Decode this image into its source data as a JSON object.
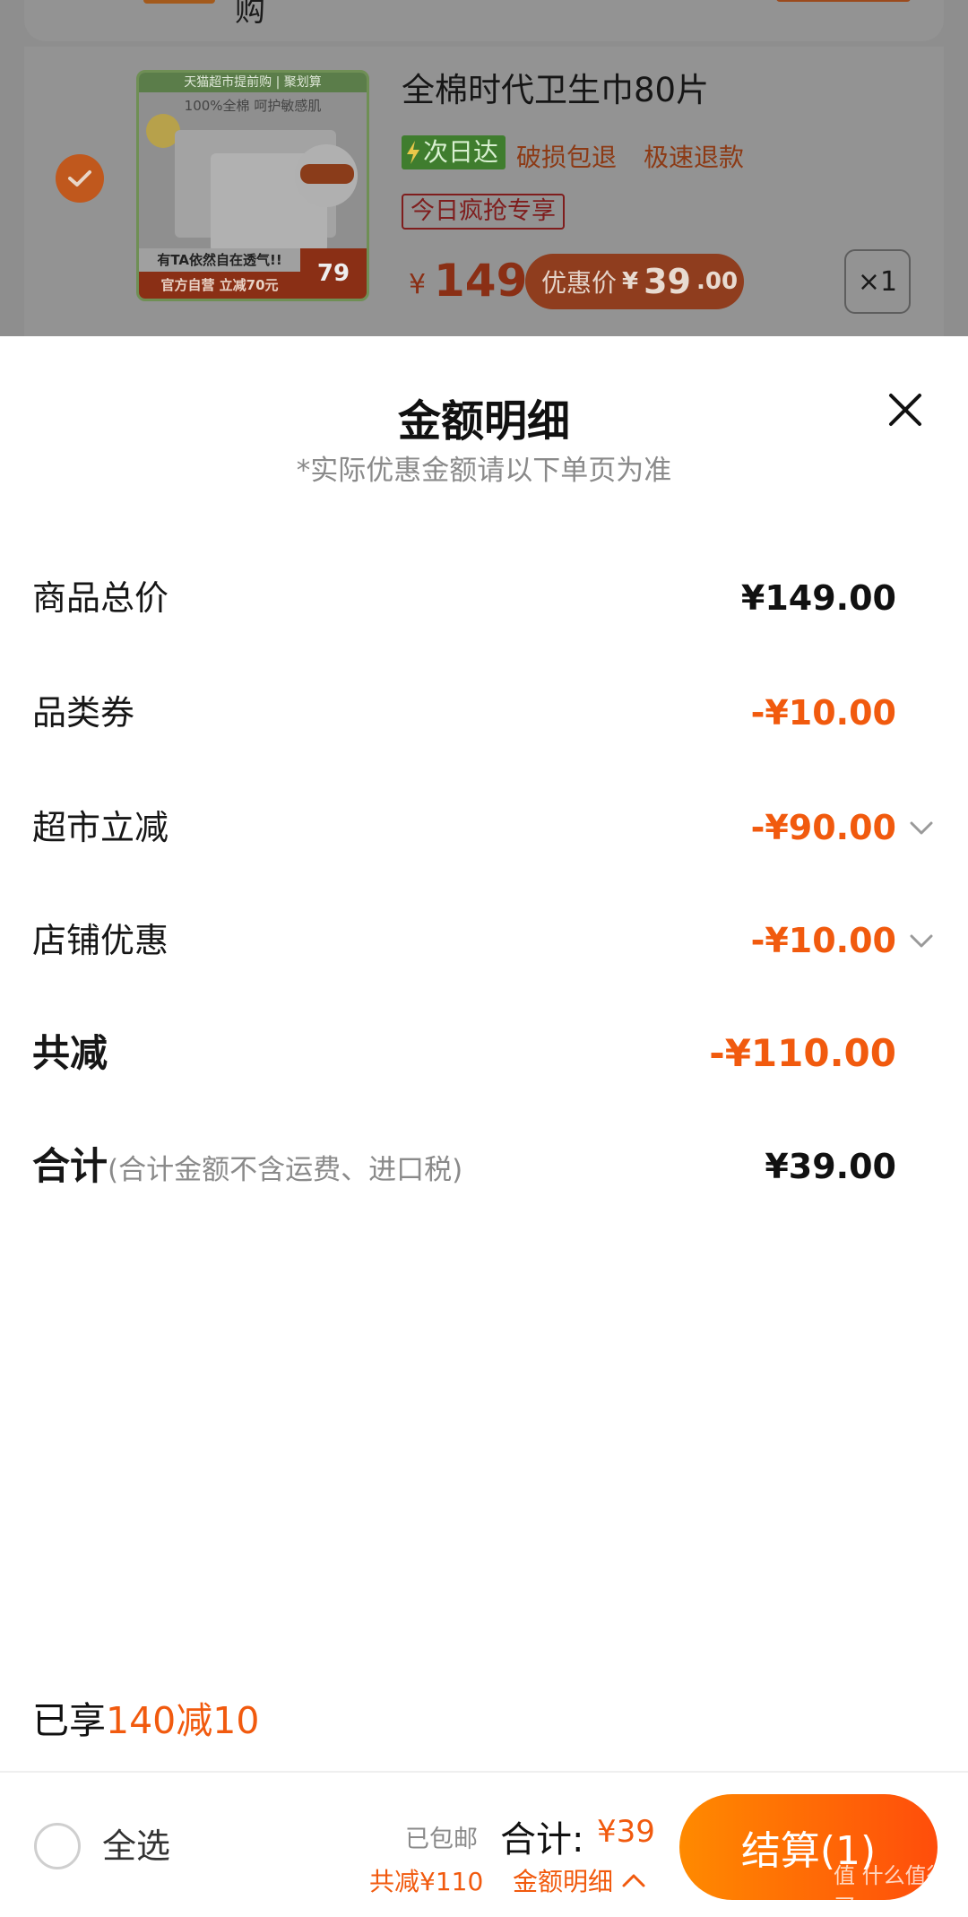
{
  "cart_background": {
    "top_text": "购",
    "product": {
      "title": "全棉时代卫生巾80片",
      "image": {
        "banner": "天猫超市提前购 | 聚划算",
        "line": "100%全棉 呵护敏感肌",
        "slogan": "有TA依然自在透气!!",
        "store": "官方自营 立减70元",
        "price": "79"
      },
      "tags": [
        "次日达",
        "破损包退",
        "极速退款"
      ],
      "promo_tag": "今日疯抢专享",
      "price_symbol": "¥",
      "price": "149",
      "promo_label": "优惠价",
      "promo_symbol": "¥",
      "promo_price_int": "39",
      "promo_price_dec": ".00",
      "quantity": "×1",
      "checked": true
    }
  },
  "sheet": {
    "title": "金额明细",
    "subtitle": "*实际优惠金额请以下单页为准",
    "rows": [
      {
        "label": "商品总价",
        "value": "¥149.00",
        "style": "black",
        "expandable": false
      },
      {
        "label": "品类券",
        "value": "-¥10.00",
        "style": "orange",
        "expandable": false
      },
      {
        "label": "超市立减",
        "value": "-¥90.00",
        "style": "orange",
        "expandable": true
      },
      {
        "label": "店铺优惠",
        "value": "-¥10.00",
        "style": "orange",
        "expandable": true
      },
      {
        "label": "共减",
        "value": "-¥110.00",
        "style": "orange",
        "expandable": false
      },
      {
        "label": "合计",
        "note": "(合计金额不含运费、进口税)",
        "value": "¥39.00",
        "style": "black",
        "expandable": false
      }
    ],
    "enjoyed_prefix": "已享",
    "enjoyed_value": "140减10"
  },
  "bottom_bar": {
    "select_all": "全选",
    "shipping": "已包邮",
    "total_label": "合计:",
    "total_value": "¥39",
    "reduced": "共减¥110",
    "detail_link": "金额明细",
    "checkout": "结算(1)"
  },
  "watermark": "值 什么值得买",
  "colors": {
    "accent": "#f15a0e",
    "checkout_gradient_start": "#ff8a00",
    "checkout_gradient_end": "#ff4d0b"
  }
}
